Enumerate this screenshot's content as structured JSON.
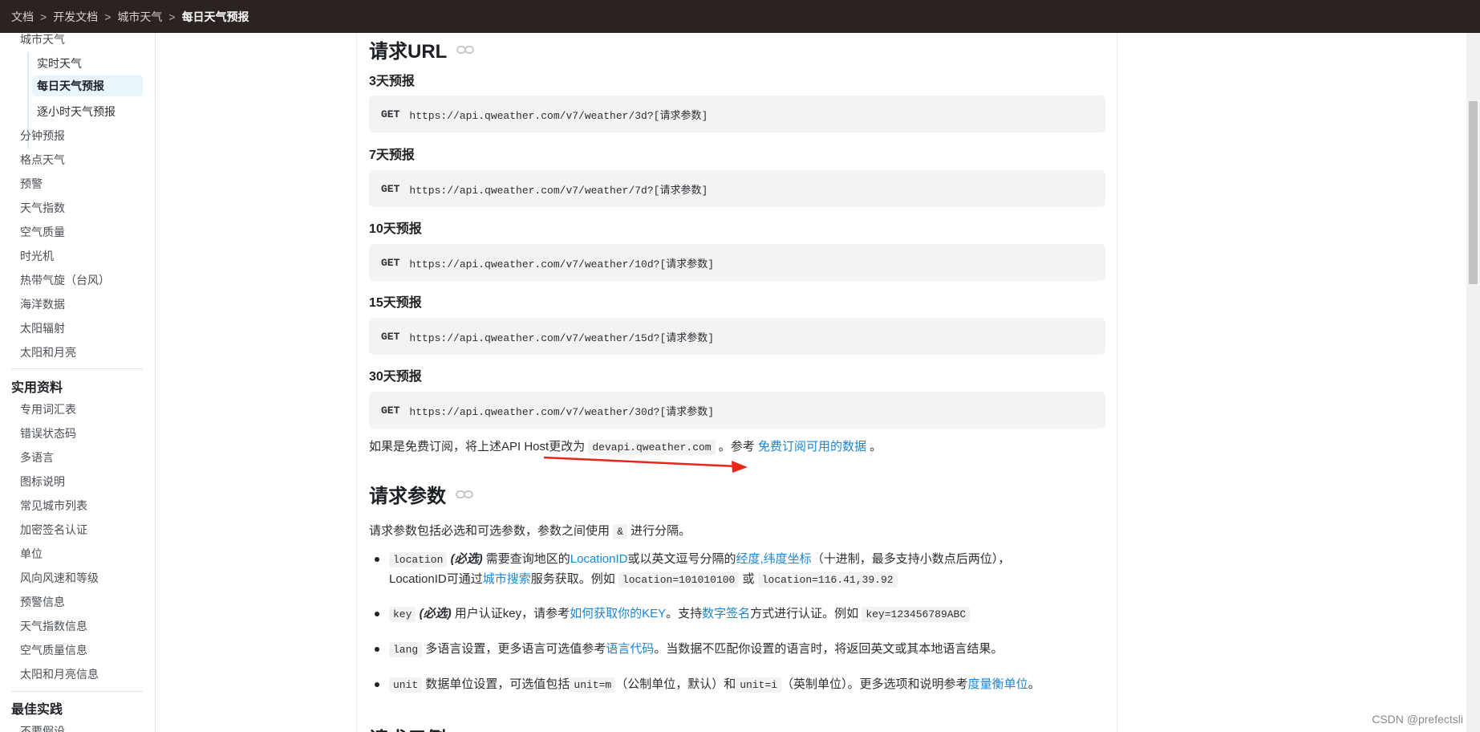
{
  "breadcrumb": {
    "items": [
      "文档",
      "开发文档",
      "城市天气"
    ],
    "separator": ">",
    "current": "每日天气预报"
  },
  "sidebar": {
    "parent": "城市天气",
    "subitems": [
      "实时天气",
      "每日天气预报",
      "逐小时天气预报"
    ],
    "active_subitem": "每日天气预报",
    "items": [
      "分钟预报",
      "格点天气",
      "预警",
      "天气指数",
      "空气质量",
      "时光机",
      "热带气旋（台风）",
      "海洋数据",
      "太阳辐射",
      "太阳和月亮"
    ],
    "section2_title": "实用资料",
    "section2_items": [
      "专用词汇表",
      "错误状态码",
      "多语言",
      "图标说明",
      "常见城市列表",
      "加密签名认证",
      "单位",
      "风向风速和等级",
      "预警信息",
      "天气指数信息",
      "空气质量信息",
      "太阳和月亮信息"
    ],
    "section3_title": "最佳实践",
    "section3_partial": "不要假设"
  },
  "main": {
    "request_url_title": "请求URL",
    "forecasts": [
      {
        "label": "3天预报",
        "method": "GET",
        "url": "https://api.qweather.com/v7/weather/3d?[请求参数]"
      },
      {
        "label": "7天预报",
        "method": "GET",
        "url": "https://api.qweather.com/v7/weather/7d?[请求参数]"
      },
      {
        "label": "10天预报",
        "method": "GET",
        "url": "https://api.qweather.com/v7/weather/10d?[请求参数]"
      },
      {
        "label": "15天预报",
        "method": "GET",
        "url": "https://api.qweather.com/v7/weather/15d?[请求参数]"
      },
      {
        "label": "30天预报",
        "method": "GET",
        "url": "https://api.qweather.com/v7/weather/30d?[请求参数]"
      }
    ],
    "free_note": {
      "text1": "如果是免费订阅，将上述API Host更改为",
      "code": "devapi.qweather.com",
      "text2": "。参考",
      "link": "免费订阅可用的数据",
      "text3": "。"
    },
    "params_title": "请求参数",
    "params_intro": {
      "text1": "请求参数包括必选和可选参数，参数之间使用",
      "code": "&",
      "text2": "进行分隔。"
    },
    "params": {
      "location": {
        "name": "location",
        "required": "(必选)",
        "text1": "需要查询地区的",
        "link1": "LocationID",
        "text2": "或以英文逗号分隔的",
        "link2": "经度,纬度坐标",
        "text3": "（十进制，最多支持小数点后两位），",
        "line2_text1": "LocationID可通过",
        "link3": "城市搜索",
        "line2_text2": "服务获取。例如",
        "example1": "location=101010100",
        "or": "或",
        "example2": "location=116.41,39.92"
      },
      "key": {
        "name": "key",
        "required": "(必选)",
        "text1": "用户认证key，请参考",
        "link1": "如何获取你的KEY",
        "text2": "。支持",
        "link2": "数字签名",
        "text3": "方式进行认证。例如",
        "example": "key=123456789ABC"
      },
      "lang": {
        "name": "lang",
        "text1": "多语言设置，更多语言可选值参考",
        "link1": "语言代码",
        "text2": "。当数据不匹配你设置的语言时，将返回英文或其本地语言结果。"
      },
      "unit": {
        "name": "unit",
        "text1": "数据单位设置，可选值包括",
        "code1": "unit=m",
        "text2": "（公制单位，默认）和",
        "code2": "unit=i",
        "text3": "（英制单位）。更多选项和说明参考",
        "link1": "度量衡单位",
        "text4": "。"
      }
    },
    "next_heading_partial": "请求示例"
  },
  "watermark": "CSDN @prefectsli",
  "colors": {
    "topbar_bg": "#2a2321",
    "link": "#1b86d6",
    "arrow": "#e8261c",
    "codebox_bg": "#f3f3f4",
    "active_bg": "#eaf4fb"
  }
}
